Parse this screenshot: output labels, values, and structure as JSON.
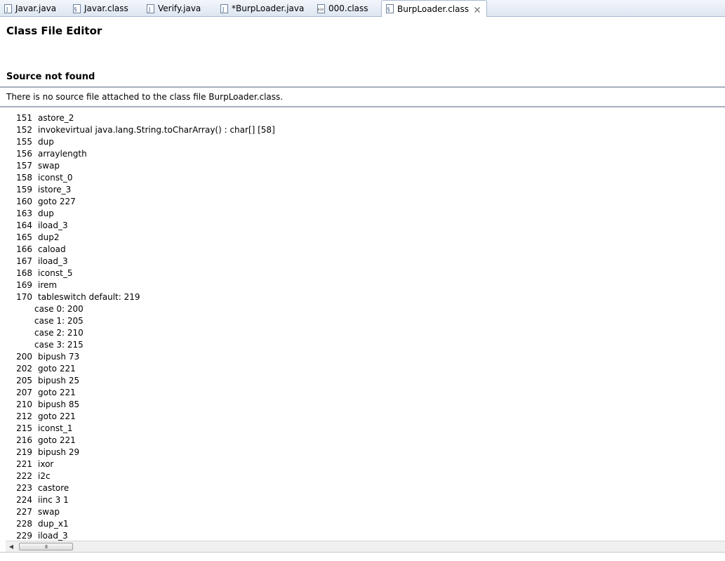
{
  "tabs": [
    {
      "label": "Javar.java",
      "icon": "java-file-icon"
    },
    {
      "label": "Javar.class",
      "icon": "class-file-icon"
    },
    {
      "label": "Verify.java",
      "icon": "java-file-icon"
    },
    {
      "label": "*BurpLoader.java",
      "icon": "java-file-icon"
    },
    {
      "label": "000.class",
      "icon": "binary-file-icon"
    },
    {
      "label": "BurpLoader.class",
      "icon": "class-file-icon",
      "active": true
    }
  ],
  "editor": {
    "title": "Class File Editor",
    "section_title": "Source not found",
    "message": "There is no source file attached to the class file BurpLoader.class."
  },
  "bytecode": [
    {
      "n": "151",
      "op": "astore_2"
    },
    {
      "n": "152",
      "op": "invokevirtual java.lang.String.toCharArray() : char[] [58]"
    },
    {
      "n": "155",
      "op": "dup"
    },
    {
      "n": "156",
      "op": "arraylength"
    },
    {
      "n": "157",
      "op": "swap"
    },
    {
      "n": "158",
      "op": "iconst_0"
    },
    {
      "n": "159",
      "op": "istore_3"
    },
    {
      "n": "160",
      "op": "goto 227"
    },
    {
      "n": "163",
      "op": "dup"
    },
    {
      "n": "164",
      "op": "iload_3"
    },
    {
      "n": "165",
      "op": "dup2"
    },
    {
      "n": "166",
      "op": "caload"
    },
    {
      "n": "167",
      "op": "iload_3"
    },
    {
      "n": "168",
      "op": "iconst_5"
    },
    {
      "n": "169",
      "op": "irem"
    },
    {
      "n": "170",
      "op": "tableswitch default: 219"
    },
    {
      "n": "",
      "op": "case 0: 200"
    },
    {
      "n": "",
      "op": "case 1: 205"
    },
    {
      "n": "",
      "op": "case 2: 210"
    },
    {
      "n": "",
      "op": "case 3: 215"
    },
    {
      "n": "200",
      "op": "bipush 73"
    },
    {
      "n": "202",
      "op": "goto 221"
    },
    {
      "n": "205",
      "op": "bipush 25"
    },
    {
      "n": "207",
      "op": "goto 221"
    },
    {
      "n": "210",
      "op": "bipush 85"
    },
    {
      "n": "212",
      "op": "goto 221"
    },
    {
      "n": "215",
      "op": "iconst_1"
    },
    {
      "n": "216",
      "op": "goto 221"
    },
    {
      "n": "219",
      "op": "bipush 29"
    },
    {
      "n": "221",
      "op": "ixor"
    },
    {
      "n": "222",
      "op": "i2c"
    },
    {
      "n": "223",
      "op": "castore"
    },
    {
      "n": "224",
      "op": "iinc 3 1"
    },
    {
      "n": "227",
      "op": "swap"
    },
    {
      "n": "228",
      "op": "dup_x1"
    },
    {
      "n": "229",
      "op": "iload_3"
    }
  ],
  "scrollbar": {
    "left_arrow": "◀",
    "thumb_grip": "III"
  }
}
